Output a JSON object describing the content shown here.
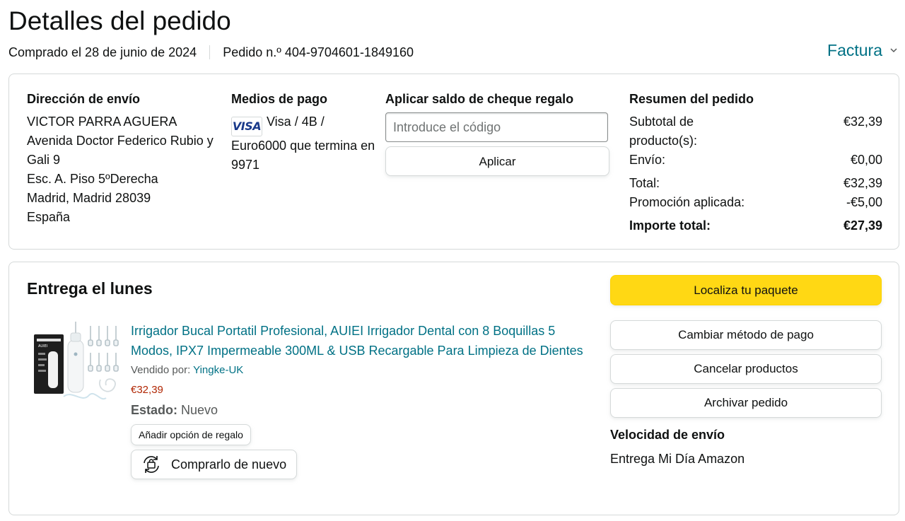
{
  "page": {
    "title": "Detalles del pedido",
    "purchased": "Comprado el 28 de junio de 2024",
    "order_number": "Pedido n.º 404-9704601-1849160",
    "invoice_label": "Factura"
  },
  "shipping": {
    "title": "Dirección de envío",
    "lines": [
      "VICTOR PARRA AGUERA",
      "Avenida Doctor Federico Rubio y Gali 9",
      "Esc. A. Piso 5ºDerecha",
      "Madrid, Madrid 28039",
      "España"
    ]
  },
  "payment": {
    "title": "Medios de pago",
    "card_logo": "VISA",
    "text": "Visa / 4B / Euro6000 que termina en 9971"
  },
  "gift_card": {
    "title": "Aplicar saldo de cheque regalo",
    "placeholder": "Introduce el código",
    "apply_label": "Aplicar"
  },
  "summary": {
    "title": "Resumen del pedido",
    "subtotal_label": "Subtotal de producto(s):",
    "subtotal_value": "€32,39",
    "shipping_label": "Envío:",
    "shipping_value": "€0,00",
    "total_label": "Total:",
    "total_value": "€32,39",
    "promo_label": "Promoción aplicada:",
    "promo_value": "-€5,00",
    "grand_total_label": "Importe total:",
    "grand_total_value": "€27,39"
  },
  "delivery": {
    "title": "Entrega el lunes",
    "product_title": "Irrigador Bucal Portatil Profesional, AUIEI Irrigador Dental con 8 Boquillas 5 Modos, IPX7 Impermeable 300ML & USB Recargable Para Limpieza de Dientes",
    "sold_by_label": "Vendido por:",
    "seller": "Yingke-UK",
    "price": "€32,39",
    "condition_label": "Estado:",
    "condition_value": "Nuevo",
    "gift_option_label": "Añadir opción de regalo",
    "buy_again_label": "Comprarlo de nuevo",
    "box_brand": "AUIEI"
  },
  "actions": {
    "track": "Localiza tu paquete",
    "change_payment": "Cambiar método de pago",
    "cancel": "Cancelar productos",
    "archive": "Archivar pedido",
    "shipping_speed_title": "Velocidad de envío",
    "shipping_speed": "Entrega Mi Día Amazon"
  },
  "colors": {
    "link": "#007185",
    "price": "#b12704",
    "track_button": "#ffd814",
    "border": "#d5d9d9"
  },
  "icons": [
    "chevron-down-icon",
    "visa-logo",
    "buy-again-icon"
  ]
}
